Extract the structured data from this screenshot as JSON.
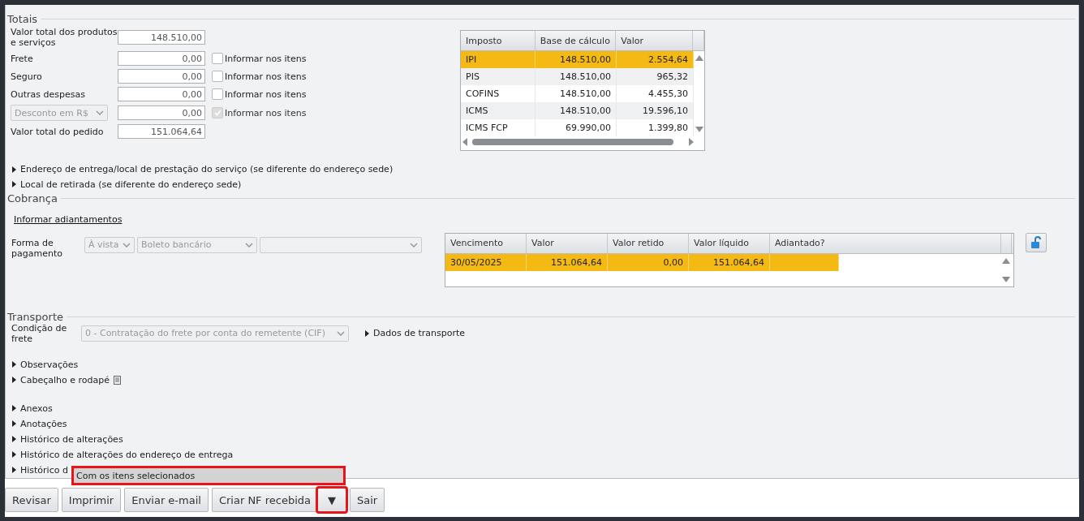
{
  "totals": {
    "title": "Totais",
    "rows": [
      {
        "kind": "field",
        "label": "Valor total dos produtos e serviços",
        "value": "148.510,00"
      },
      {
        "kind": "field",
        "label": "Frete",
        "value": "0,00",
        "option": {
          "label": "Informar nos itens",
          "checked": false,
          "disabled": false
        }
      },
      {
        "kind": "field",
        "label": "Seguro",
        "value": "0,00",
        "option": {
          "label": "Informar nos itens",
          "checked": false,
          "disabled": false
        }
      },
      {
        "kind": "field",
        "label": "Outras despesas",
        "value": "0,00",
        "option": {
          "label": "Informar nos itens",
          "checked": false,
          "disabled": false
        }
      },
      {
        "kind": "select",
        "label": "Desconto em R$",
        "value": "0,00",
        "option": {
          "label": "Informar nos itens",
          "checked": true,
          "disabled": true
        }
      },
      {
        "kind": "field",
        "label": "Valor total do pedido",
        "value": "151.064,64"
      }
    ],
    "tax_table": {
      "columns": [
        "Imposto",
        "Base de cálculo",
        "Valor"
      ],
      "rows": [
        {
          "cells": [
            "IPI",
            "148.510,00",
            "2.554,64"
          ],
          "selected": true
        },
        {
          "cells": [
            "PIS",
            "148.510,00",
            "965,32"
          ],
          "selected": false
        },
        {
          "cells": [
            "COFINS",
            "148.510,00",
            "4.455,30"
          ],
          "selected": false
        },
        {
          "cells": [
            "ICMS",
            "148.510,00",
            "19.596,10"
          ],
          "selected": false
        },
        {
          "cells": [
            "ICMS FCP",
            "69.990,00",
            "1.399,80"
          ],
          "selected": false
        }
      ]
    },
    "expanders": [
      "Endereço de entrega/local de prestação do serviço (se diferente do endereço sede)",
      "Local de retirada (se diferente do endereço sede)"
    ]
  },
  "cobranca": {
    "title": "Cobrança",
    "link": "Informar adiantamentos",
    "payment_label": "Forma de pagamento",
    "selects": [
      {
        "value": "À vista",
        "disabled": true
      },
      {
        "value": "Boleto bancário",
        "disabled": true
      },
      {
        "disabled": true
      }
    ],
    "installments": {
      "columns": [
        "Vencimento",
        "Valor",
        "Valor retido",
        "Valor líquido",
        "Adiantado?"
      ],
      "rows": [
        {
          "cells": [
            "30/05/2025",
            "151.064,64",
            "0,00",
            "151.064,64",
            ""
          ],
          "selected": true
        }
      ]
    }
  },
  "transporte": {
    "title": "Transporte",
    "label": "Condição de frete",
    "select": "0 - Contratação do frete por conta do remetente (CIF)",
    "link": "Dados de transporte"
  },
  "expander_groups": [
    [
      {
        "label": "Observações",
        "note_icon": false
      },
      {
        "label": "Cabeçalho e rodapé",
        "note_icon": true
      }
    ],
    [
      {
        "label": "Anexos",
        "note_icon": false
      },
      {
        "label": "Anotações",
        "note_icon": false
      },
      {
        "label": "Histórico de alterações",
        "note_icon": false
      },
      {
        "label": "Histórico de alterações do endereço de entrega",
        "note_icon": false
      },
      {
        "label": "Histórico d"
      }
    ]
  ],
  "popup_menu": {
    "items": [
      "Com os itens selecionados"
    ],
    "highlighted": true
  },
  "buttons": [
    {
      "kind": "button",
      "label": "Revisar",
      "highlighted": false
    },
    {
      "kind": "button",
      "label": "Imprimir",
      "highlighted": false
    },
    {
      "kind": "button",
      "label": "Enviar e-mail",
      "highlighted": false
    },
    {
      "kind": "split",
      "label": "Criar NF recebida",
      "highlighted": false
    },
    {
      "kind": "menu",
      "label": "▼",
      "highlighted": true
    },
    {
      "kind": "button",
      "label": "Sair",
      "highlighted": false
    }
  ]
}
